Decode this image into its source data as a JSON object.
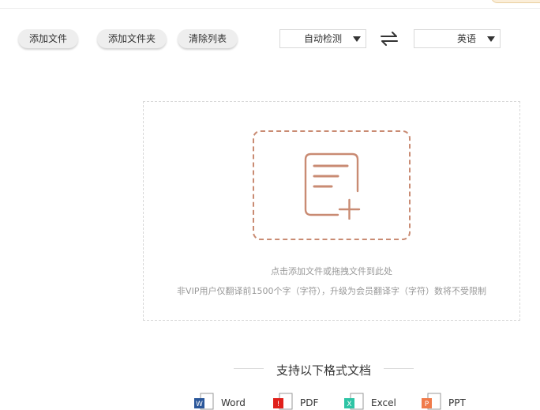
{
  "toolbar": {
    "add_file": "添加文件",
    "add_folder": "添加文件夹",
    "clear_list": "清除列表"
  },
  "language": {
    "source": "自动检测",
    "target": "英语"
  },
  "dropzone": {
    "hint_primary": "点击添加文件或拖拽文件到此处",
    "hint_secondary": "非VIP用户仅翻译前1500个字（字符），升级为会员翻译字（字符）数将不受限制"
  },
  "formats": {
    "title": "支持以下格式文档",
    "items": [
      {
        "label": "Word",
        "badge": "W",
        "color": "#2b579a"
      },
      {
        "label": "PDF",
        "badge": "!",
        "color": "#e0201b"
      },
      {
        "label": "Excel",
        "badge": "X",
        "color": "#2ec4a5"
      },
      {
        "label": "PPT",
        "badge": "P",
        "color": "#f07b4b"
      }
    ]
  },
  "colors": {
    "accent": "#c98b73",
    "dashed_border": "#d8d8d8",
    "hint_text": "#999999"
  }
}
